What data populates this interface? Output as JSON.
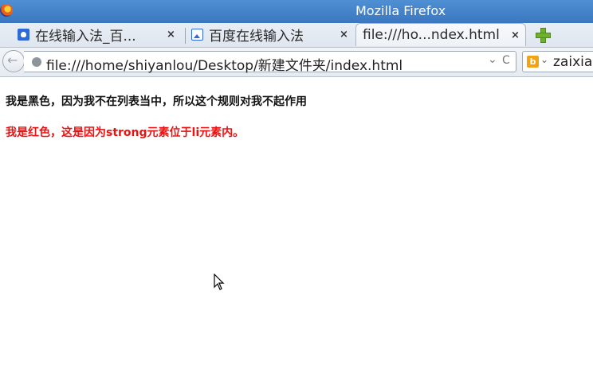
{
  "window": {
    "title": "Mozilla Firefox"
  },
  "tabs": [
    {
      "label": "在线输入法_百...",
      "icon": "baidu-paw-icon",
      "close": "×"
    },
    {
      "label": "百度在线输入法",
      "icon": "image-icon",
      "close": "×"
    },
    {
      "label": "file:///ho...ndex.html",
      "icon": "none",
      "close": "×",
      "active": true
    }
  ],
  "newtab_icon": "plus-icon",
  "navbar": {
    "url": "file:///home/shiyanlou/Desktop/新建文件夹/index.html",
    "dropdown_glyph": "⌄",
    "reload_glyph": "C",
    "search_engine_icon": "bing-icon",
    "search_engine_glyph": "b",
    "search_text": "zaixia"
  },
  "page": {
    "line1": "我是黑色，因为我不在列表当中，所以这个规则对我不起作用",
    "line2": "我是红色，这是因为strong元素位于li元素内。",
    "line1_color": "#111111",
    "line2_color": "#ee1111"
  },
  "colors": {
    "titlebar": "#3a77bf",
    "newtab_green": "#6fb02e",
    "search_engine": "#f0a315"
  }
}
